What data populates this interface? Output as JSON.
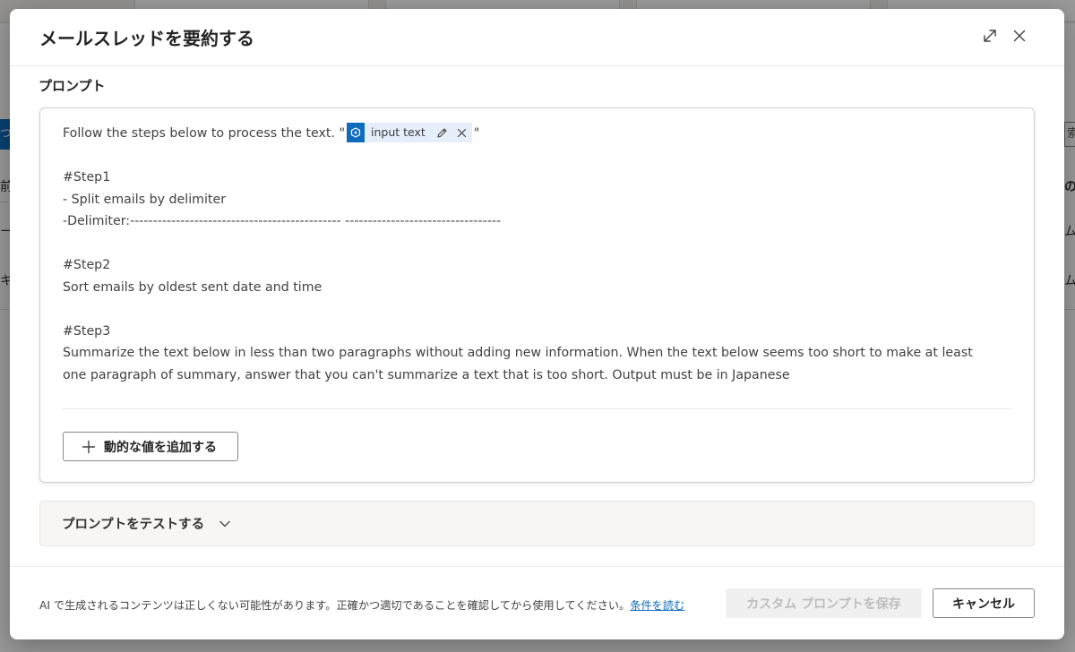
{
  "background": {
    "blue_tab_fragment": "つ",
    "left_fragments": [
      "前",
      "ー",
      "キ"
    ],
    "right_fragments": [
      "の",
      "ム",
      "ム"
    ],
    "search_fragment": "索"
  },
  "dialog": {
    "title": "メールスレッドを要約する",
    "expand_icon": "expand-icon",
    "close_icon": "close-icon"
  },
  "prompt_section": {
    "label": "プロンプト",
    "line1_before": "Follow the steps below to process the text.  \"",
    "line1_after": "\"",
    "input_chip": {
      "label": "input text",
      "logo_icon": "ai-builder-icon",
      "edit_icon": "pencil-icon",
      "remove_icon": "close-icon",
      "accent": "#0f6cbd"
    },
    "lines": [
      "",
      "#Step1",
      "- Split emails by delimiter",
      "-Delimiter:---------------------------------------------- ----------------------------------",
      "",
      "#Step2",
      "Sort emails by oldest sent date and time",
      "",
      "#Step3",
      "Summarize the text below in less than two paragraphs without adding new information. When the text below seems too short to make at least one paragraph of summary, answer that you can't summarize a text that is too short. Output must be in Japanese"
    ],
    "add_dynamic_value_label": "動的な値を追加する",
    "add_icon": "plus-icon"
  },
  "test_prompt": {
    "label": "プロンプトをテストする",
    "chevron_icon": "chevron-down-icon"
  },
  "footer": {
    "disclaimer": "AI で生成されるコンテンツは正しくない可能性があります。正確かつ適切であることを確認してから使用してください。",
    "terms_link": "条件を読む",
    "save_label": "カスタム プロンプトを保存",
    "cancel_label": "キャンセル"
  }
}
